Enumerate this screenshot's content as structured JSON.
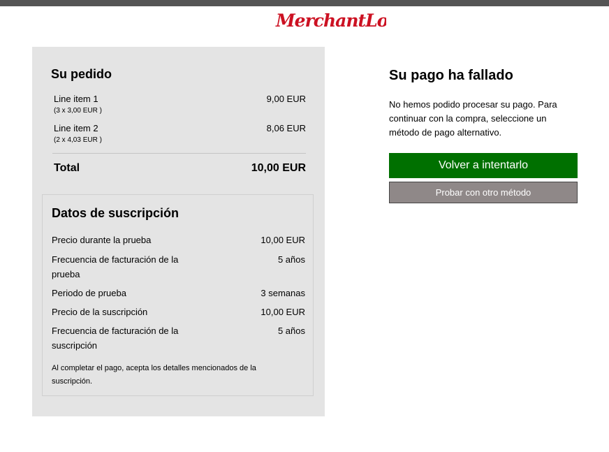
{
  "logo": {
    "text": "MerchantLogo",
    "color": "#cc1122"
  },
  "order": {
    "title": "Su pedido",
    "items": [
      {
        "name": "Line item 1",
        "detail": "(3 x 3,00 EUR )",
        "price": "9,00 EUR"
      },
      {
        "name": "Line item 2",
        "detail": "(2 x 4,03 EUR )",
        "price": "8,06 EUR"
      }
    ],
    "total_label": "Total",
    "total_value": "10,00 EUR"
  },
  "subscription": {
    "title": "Datos de suscripción",
    "rows": [
      {
        "label": "Precio durante la prueba",
        "value": "10,00 EUR"
      },
      {
        "label": "Frecuencia de facturación de la prueba",
        "value": "5 años"
      },
      {
        "label": "Periodo de prueba",
        "value": "3 semanas"
      },
      {
        "label": "Precio de la suscripción",
        "value": "10,00 EUR"
      },
      {
        "label": "Frecuencia de facturación de la suscripción",
        "value": "5 años"
      }
    ],
    "note": "Al completar el pago, acepta los detalles mencionados de la suscripción."
  },
  "payment": {
    "title": "Su pago ha fallado",
    "message": "No hemos podido procesar su pago. Para continuar con la compra, seleccione un método de pago alternativo.",
    "retry_label": "Volver a intentarlo",
    "other_label": "Probar con otro método",
    "retry_color": "#007000",
    "other_color": "#8f8888"
  }
}
